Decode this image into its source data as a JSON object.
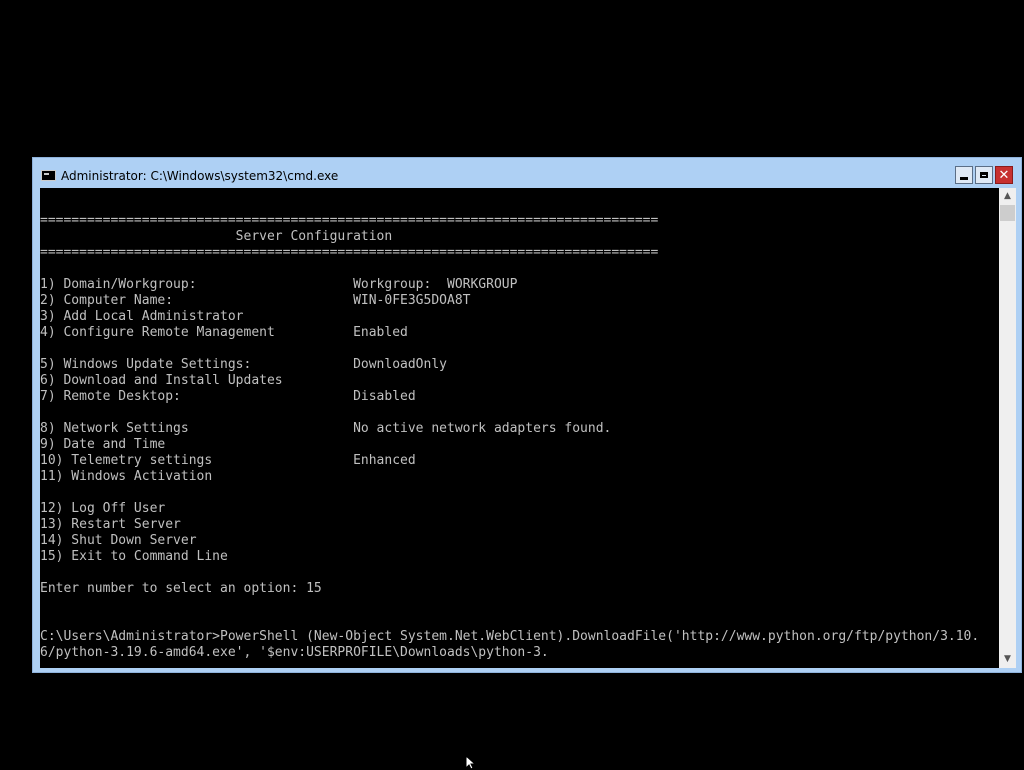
{
  "window": {
    "title": "Administrator: C:\\Windows\\system32\\cmd.exe",
    "icon": "cmd-icon",
    "controls": {
      "minimize": "minimize-icon",
      "maximize": "maximize-icon",
      "close": "close-icon"
    }
  },
  "console": {
    "lines": [
      "",
      "===============================================================================",
      "                         Server Configuration",
      "===============================================================================",
      "",
      "1) Domain/Workgroup:                    Workgroup:  WORKGROUP",
      "2) Computer Name:                       WIN-0FE3G5DOA8T",
      "3) Add Local Administrator",
      "4) Configure Remote Management          Enabled",
      "",
      "5) Windows Update Settings:             DownloadOnly",
      "6) Download and Install Updates",
      "7) Remote Desktop:                      Disabled",
      "",
      "8) Network Settings                     No active network adapters found.",
      "9) Date and Time",
      "10) Telemetry settings                  Enhanced",
      "11) Windows Activation",
      "",
      "12) Log Off User",
      "13) Restart Server",
      "14) Shut Down Server",
      "15) Exit to Command Line",
      "",
      "Enter number to select an option: 15",
      "",
      "",
      "C:\\Users\\Administrator>PowerShell (New-Object System.Net.WebClient).DownloadFile('http://www.python.org/ftp/python/3.10.",
      "6/python-3.19.6-amd64.exe', '$env:USERPROFILE\\Downloads\\python-3."
    ]
  },
  "scrollbar": {
    "up": "▲",
    "down": "▼"
  },
  "colors": {
    "titlebar": "#aed0f4",
    "console_bg": "#000000",
    "console_text": "#c0c0c0",
    "close_button": "#c7302f"
  }
}
